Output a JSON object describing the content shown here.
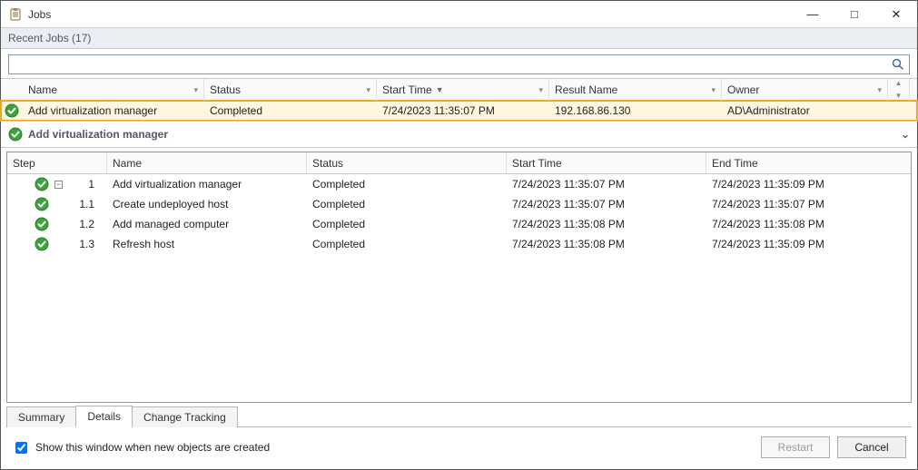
{
  "window": {
    "title": "Jobs",
    "recent_label": "Recent Jobs (17)"
  },
  "search": {
    "placeholder": ""
  },
  "jobs_columns": {
    "name": "Name",
    "status": "Status",
    "start_time": "Start Time",
    "result_name": "Result Name",
    "owner": "Owner"
  },
  "jobs": [
    {
      "name": "Add virtualization manager",
      "status": "Completed",
      "start_time": "7/24/2023 11:35:07 PM",
      "result_name": "192.168.86.130",
      "owner": "AD\\Administrator",
      "selected": true
    }
  ],
  "detail": {
    "title": "Add virtualization manager"
  },
  "steps_columns": {
    "step": "Step",
    "name": "Name",
    "status": "Status",
    "start_time": "Start Time",
    "end_time": "End Time"
  },
  "steps": [
    {
      "num": "1",
      "tree": true,
      "name": "Add virtualization manager",
      "status": "Completed",
      "start": "7/24/2023 11:35:07 PM",
      "end": "7/24/2023 11:35:09 PM"
    },
    {
      "num": "1.1",
      "tree": false,
      "name": "Create undeployed host",
      "status": "Completed",
      "start": "7/24/2023 11:35:07 PM",
      "end": "7/24/2023 11:35:07 PM"
    },
    {
      "num": "1.2",
      "tree": false,
      "name": "Add managed computer",
      "status": "Completed",
      "start": "7/24/2023 11:35:08 PM",
      "end": "7/24/2023 11:35:08 PM"
    },
    {
      "num": "1.3",
      "tree": false,
      "name": "Refresh host",
      "status": "Completed",
      "start": "7/24/2023 11:35:08 PM",
      "end": "7/24/2023 11:35:09 PM"
    }
  ],
  "tabs": {
    "summary": "Summary",
    "details": "Details",
    "change_tracking": "Change Tracking",
    "active": "details"
  },
  "footer": {
    "show_checkbox_label": "Show this window when new objects are created",
    "show_checkbox_checked": true,
    "restart": "Restart",
    "cancel": "Cancel"
  }
}
